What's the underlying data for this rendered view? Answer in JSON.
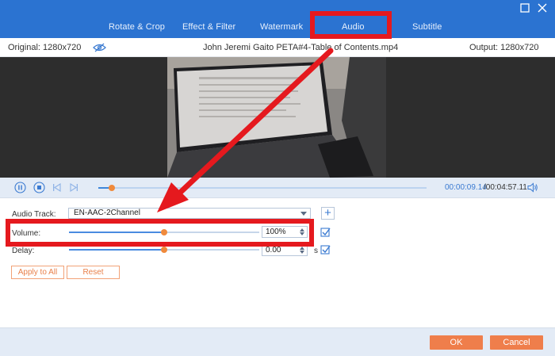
{
  "tabs": [
    {
      "label": "Rotate & Crop"
    },
    {
      "label": "Effect & Filter"
    },
    {
      "label": "Watermark"
    },
    {
      "label": "Audio"
    },
    {
      "label": "Subtitle"
    }
  ],
  "info": {
    "original": "Original: 1280x720",
    "filename": "John Jeremi Gaito PETA#4-Table of Contents.mp4",
    "output": "Output: 1280x720"
  },
  "playback": {
    "current_time": "00:00:09.14",
    "total_time": "/00:04:57.11",
    "progress_fraction": 0.04
  },
  "audio": {
    "track_label": "Audio Track:",
    "track_value": "EN-AAC-2Channel",
    "volume_label": "Volume:",
    "volume_value": "100%",
    "volume_fraction": 0.5,
    "delay_label": "Delay:",
    "delay_value": "0.00",
    "delay_fraction": 0.5,
    "delay_unit": "s"
  },
  "buttons": {
    "apply_all": "Apply to All",
    "reset": "Reset",
    "ok": "OK",
    "cancel": "Cancel"
  },
  "colors": {
    "titlebar": "#2b73d1",
    "accent_orange": "#ef7e4b",
    "annotation_red": "#e5191e"
  }
}
